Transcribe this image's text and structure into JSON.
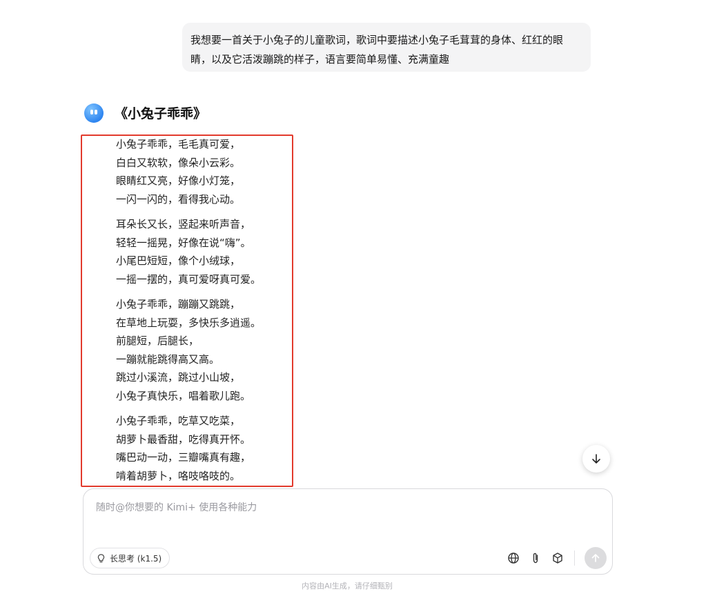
{
  "user_message": {
    "line1": "我想要一首关于小兔子的儿童歌词，歌词中要描述小兔子毛茸茸的身体、红红的眼",
    "line2": "睛，以及它活泼蹦跳的样子，语言要简单易懂、充满童趣"
  },
  "response": {
    "title": "《小兔子乖乖》",
    "stanzas": [
      [
        "小兔子乖乖，毛毛真可爱，",
        "白白又软软，像朵小云彩。",
        "眼睛红又亮，好像小灯笼，",
        "一闪一闪的，看得我心动。"
      ],
      [
        "耳朵长又长，竖起来听声音，",
        "轻轻一摇晃，好像在说“嗨”。",
        "小尾巴短短，像个小绒球，",
        "一摇一摆的，真可爱呀真可爱。"
      ],
      [
        "小兔子乖乖，蹦蹦又跳跳，",
        "在草地上玩耍，多快乐多逍遥。",
        "前腿短，后腿长，",
        "一蹦就能跳得高又高。",
        "跳过小溪流，跳过小山坡，",
        "小兔子真快乐，唱着歌儿跑。"
      ],
      [
        "小兔子乖乖，吃草又吃菜，",
        "胡萝卜最香甜，吃得真开怀。",
        "嘴巴动一动，三瓣嘴真有趣，",
        "啃着胡萝卜，咯吱咯吱的。"
      ]
    ]
  },
  "composer": {
    "placeholder": "随时@你想要的 Kimi+ 使用各种能力",
    "long_think_label": "长思考 (k1.5)"
  },
  "icons": {
    "avatar": "kimi-avatar-icon",
    "scroll": "arrow-down-icon",
    "bulb": "lightbulb-icon",
    "globe": "globe-icon",
    "attach": "paperclip-icon",
    "cube": "cube-icon",
    "send": "arrow-up-icon"
  },
  "colors": {
    "highlight_border": "#e23a2c",
    "avatar_blue": "#2f86f0"
  },
  "footer": {
    "disclaimer": "内容由AI生成，请仔细甄别"
  }
}
